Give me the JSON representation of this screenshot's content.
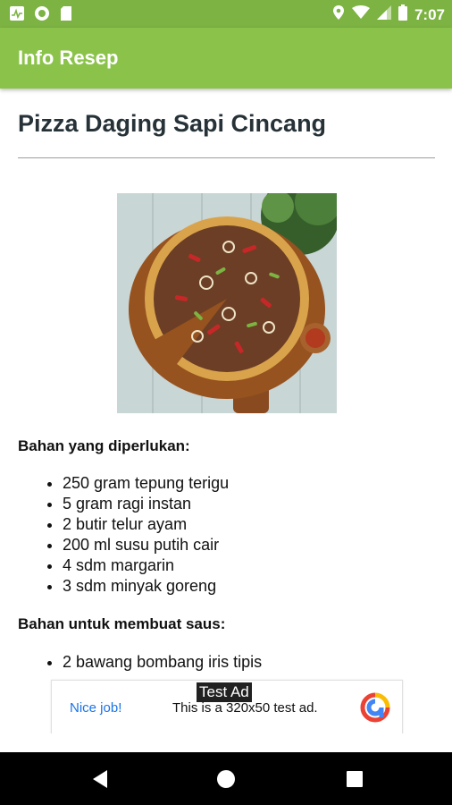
{
  "status_bar": {
    "time": "7:07",
    "left_icons": [
      "activity-icon",
      "circle-icon",
      "sd-card-icon"
    ],
    "right_icons": [
      "location-icon",
      "wifi-icon",
      "signal-icon",
      "battery-icon"
    ]
  },
  "app_bar": {
    "title": "Info Resep"
  },
  "recipe": {
    "title": "Pizza Daging Sapi Cincang",
    "image": "pizza-photo",
    "sections": [
      {
        "heading": "Bahan yang diperlukan:",
        "items": [
          "250 gram tepung terigu",
          "5 gram ragi instan",
          "2 butir telur ayam",
          "200 ml susu putih cair",
          "4 sdm margarin",
          "3 sdm minyak goreng"
        ]
      },
      {
        "heading": "Bahan untuk membuat saus:",
        "items": [
          "2 bawang bombang iris tipis"
        ]
      }
    ]
  },
  "ad": {
    "badge": "Test Ad",
    "cta": "Nice job!",
    "text": "This is a 320x50 test ad.",
    "logo": "admob-icon"
  },
  "nav_bar": {
    "buttons": [
      "back-icon",
      "home-icon",
      "recents-icon"
    ]
  }
}
